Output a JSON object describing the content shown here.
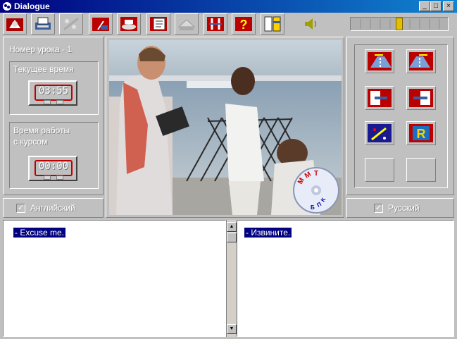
{
  "window": {
    "title": "Dialogue",
    "controls": {
      "minimize": "_",
      "maximize": "□",
      "close": "×"
    }
  },
  "toolbar": {
    "buttons": [
      {
        "icon": "bag-icon"
      },
      {
        "icon": "printer-icon"
      },
      {
        "icon": "flowers-icon"
      },
      {
        "icon": "easel-icon"
      },
      {
        "icon": "phone-icon"
      },
      {
        "icon": "notebook-icon"
      },
      {
        "icon": "disabled-keyboard-icon"
      },
      {
        "icon": "arrows-icon"
      },
      {
        "icon": "help-icon"
      },
      {
        "icon": "book-icon"
      }
    ],
    "volume_icon": "speaker-icon",
    "volume_level": 0.5
  },
  "left_panel": {
    "lesson_label": "Номер урока - 1",
    "current_time_label": "Текущее время",
    "current_time_value": "03:55",
    "course_time_label_1": "Время работы",
    "course_time_label_2": "с курсом",
    "course_time_value": "00:00",
    "english_label": "Английский"
  },
  "right_panel": {
    "buttons": [
      {
        "icon": "road-left-icon"
      },
      {
        "icon": "road-right-icon"
      },
      {
        "icon": "exit-left-icon"
      },
      {
        "icon": "exit-right-icon"
      },
      {
        "icon": "rocket-icon"
      },
      {
        "icon": "r-letter-icon",
        "text": "R"
      },
      {
        "icon": "blank-icon"
      },
      {
        "icon": "blank-icon"
      }
    ],
    "russian_label": "Русский"
  },
  "video": {
    "logo_letters": [
      "М",
      "М",
      "Т",
      "Б",
      "П",
      "К"
    ]
  },
  "text_panes": {
    "english_line": "- Excuse me.",
    "russian_line": "- Извините."
  }
}
